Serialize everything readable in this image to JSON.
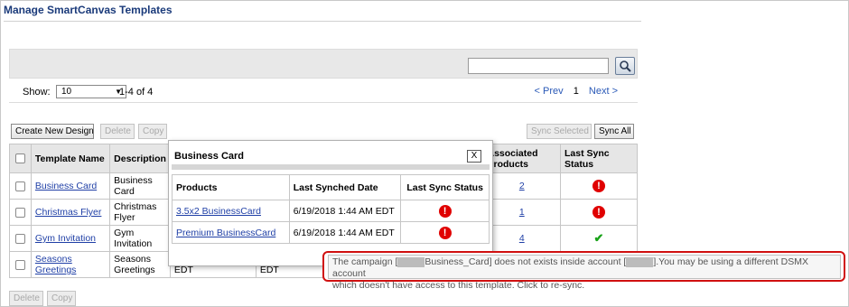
{
  "page": {
    "title": "Manage SmartCanvas Templates"
  },
  "search": {
    "placeholder": ""
  },
  "listing": {
    "show_label": "Show:",
    "page_size": "10",
    "range": "1-4 of 4",
    "prev": "< Prev",
    "current_page": "1",
    "next": "Next >"
  },
  "toolbar": {
    "create": "Create New Design",
    "delete": "Delete",
    "copy": "Copy",
    "sync_selected": "Sync Selected",
    "sync_all": "Sync All"
  },
  "table": {
    "headers": {
      "name": "Template Name",
      "description": "Description",
      "products": "Associated Products",
      "status": "Last Sync Status"
    },
    "rows": [
      {
        "name": "Business Card",
        "description": "Business Card",
        "date1": "",
        "date2": "",
        "products": "2",
        "status": "error"
      },
      {
        "name": "Christmas Flyer",
        "description": "Christmas Flyer",
        "date1": "",
        "date2": "",
        "products": "1",
        "status": "error"
      },
      {
        "name": "Gym Invitation",
        "description": "Gym Invitation",
        "date1": "",
        "date2": "",
        "products": "4",
        "status": "ok"
      },
      {
        "name": "Seasons Greetings",
        "description": "Seasons Greetings",
        "date1": "6/5/2018 5:47 AM EDT",
        "date2": "6/18/2018 5:1 EDT",
        "products": "",
        "status": ""
      }
    ]
  },
  "bottom_toolbar": {
    "delete": "Delete",
    "copy": "Copy"
  },
  "popup": {
    "title": "Business Card",
    "close": "X",
    "headers": {
      "products": "Products",
      "date": "Last Synched Date",
      "status": "Last Sync Status"
    },
    "rows": [
      {
        "product": "3.5x2 BusinessCard",
        "date": "6/19/2018 1:44 AM EDT",
        "status": "error"
      },
      {
        "product": "Premium BusinessCard",
        "date": "6/19/2018 1:44 AM EDT",
        "status": "error"
      }
    ]
  },
  "tooltip": {
    "part1": "The campaign [",
    "part2": "Business_Card] does not exists inside account [",
    "part3": "].You may be using a different DSMX account",
    "line2": "which doesn't have access to this template. Click to re-sync."
  },
  "icons": {
    "error_glyph": "!",
    "ok_glyph": "✔",
    "caret": "▼"
  },
  "colors": {
    "error": "#e00000",
    "ok": "#1aa31a",
    "link": "#1f3fa6",
    "tooltip_border": "#d01010"
  }
}
